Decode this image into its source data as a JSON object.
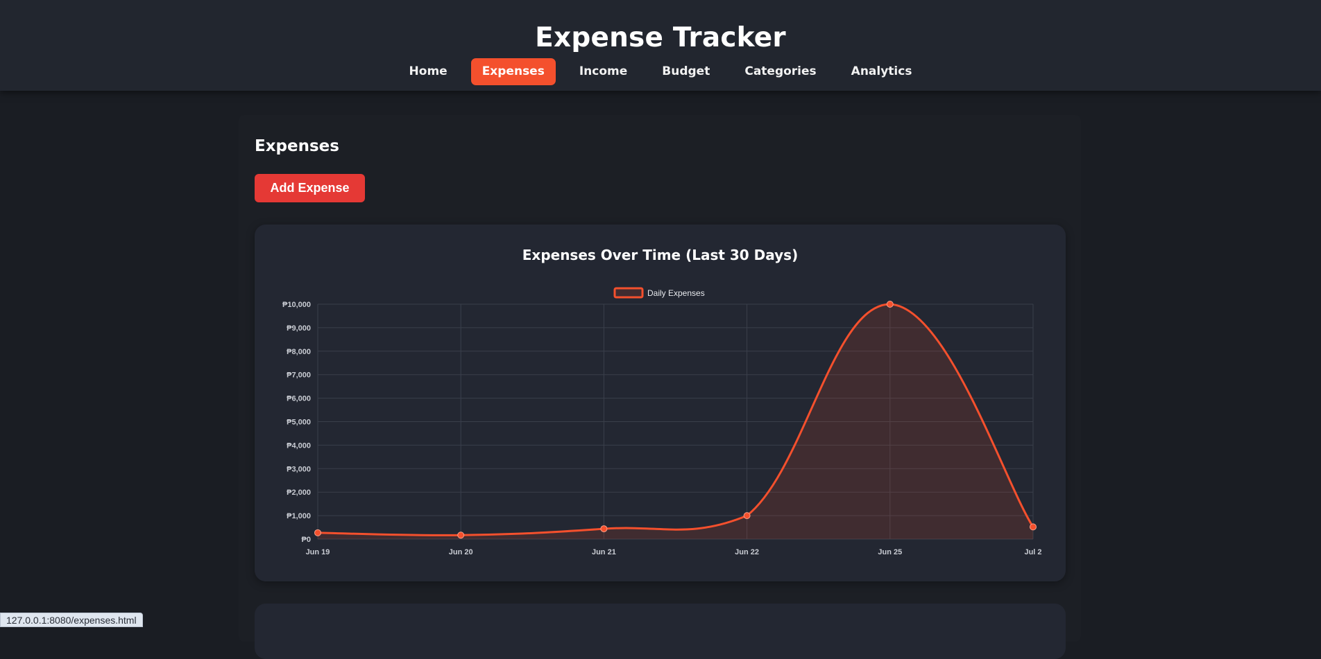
{
  "app": {
    "title": "Expense Tracker"
  },
  "nav": [
    {
      "label": "Home",
      "active": false
    },
    {
      "label": "Expenses",
      "active": true
    },
    {
      "label": "Income",
      "active": false
    },
    {
      "label": "Budget",
      "active": false
    },
    {
      "label": "Categories",
      "active": false
    },
    {
      "label": "Analytics",
      "active": false
    }
  ],
  "page": {
    "heading": "Expenses",
    "add_button_label": "Add Expense"
  },
  "colors": {
    "accent": "#f4502d",
    "button": "#e53935",
    "line": "#f4502d"
  },
  "status_bar": {
    "url": "127.0.0.1:8080/expenses.html"
  },
  "chart_data": {
    "type": "line",
    "title": "Expenses Over Time (Last 30 Days)",
    "categories": [
      "Jun 19",
      "Jun 20",
      "Jun 21",
      "Jun 22",
      "Jun 25",
      "Jul 2"
    ],
    "series": [
      {
        "name": "Daily Expenses",
        "values": [
          270,
          170,
          440,
          1000,
          10000,
          520
        ]
      }
    ],
    "ylim": [
      0,
      10000
    ],
    "yticks": [
      0,
      1000,
      2000,
      3000,
      4000,
      5000,
      6000,
      7000,
      8000,
      9000,
      10000
    ],
    "y_tick_prefix": "₱",
    "legend_position": "top",
    "fill": true,
    "smooth": true,
    "grid": true
  }
}
